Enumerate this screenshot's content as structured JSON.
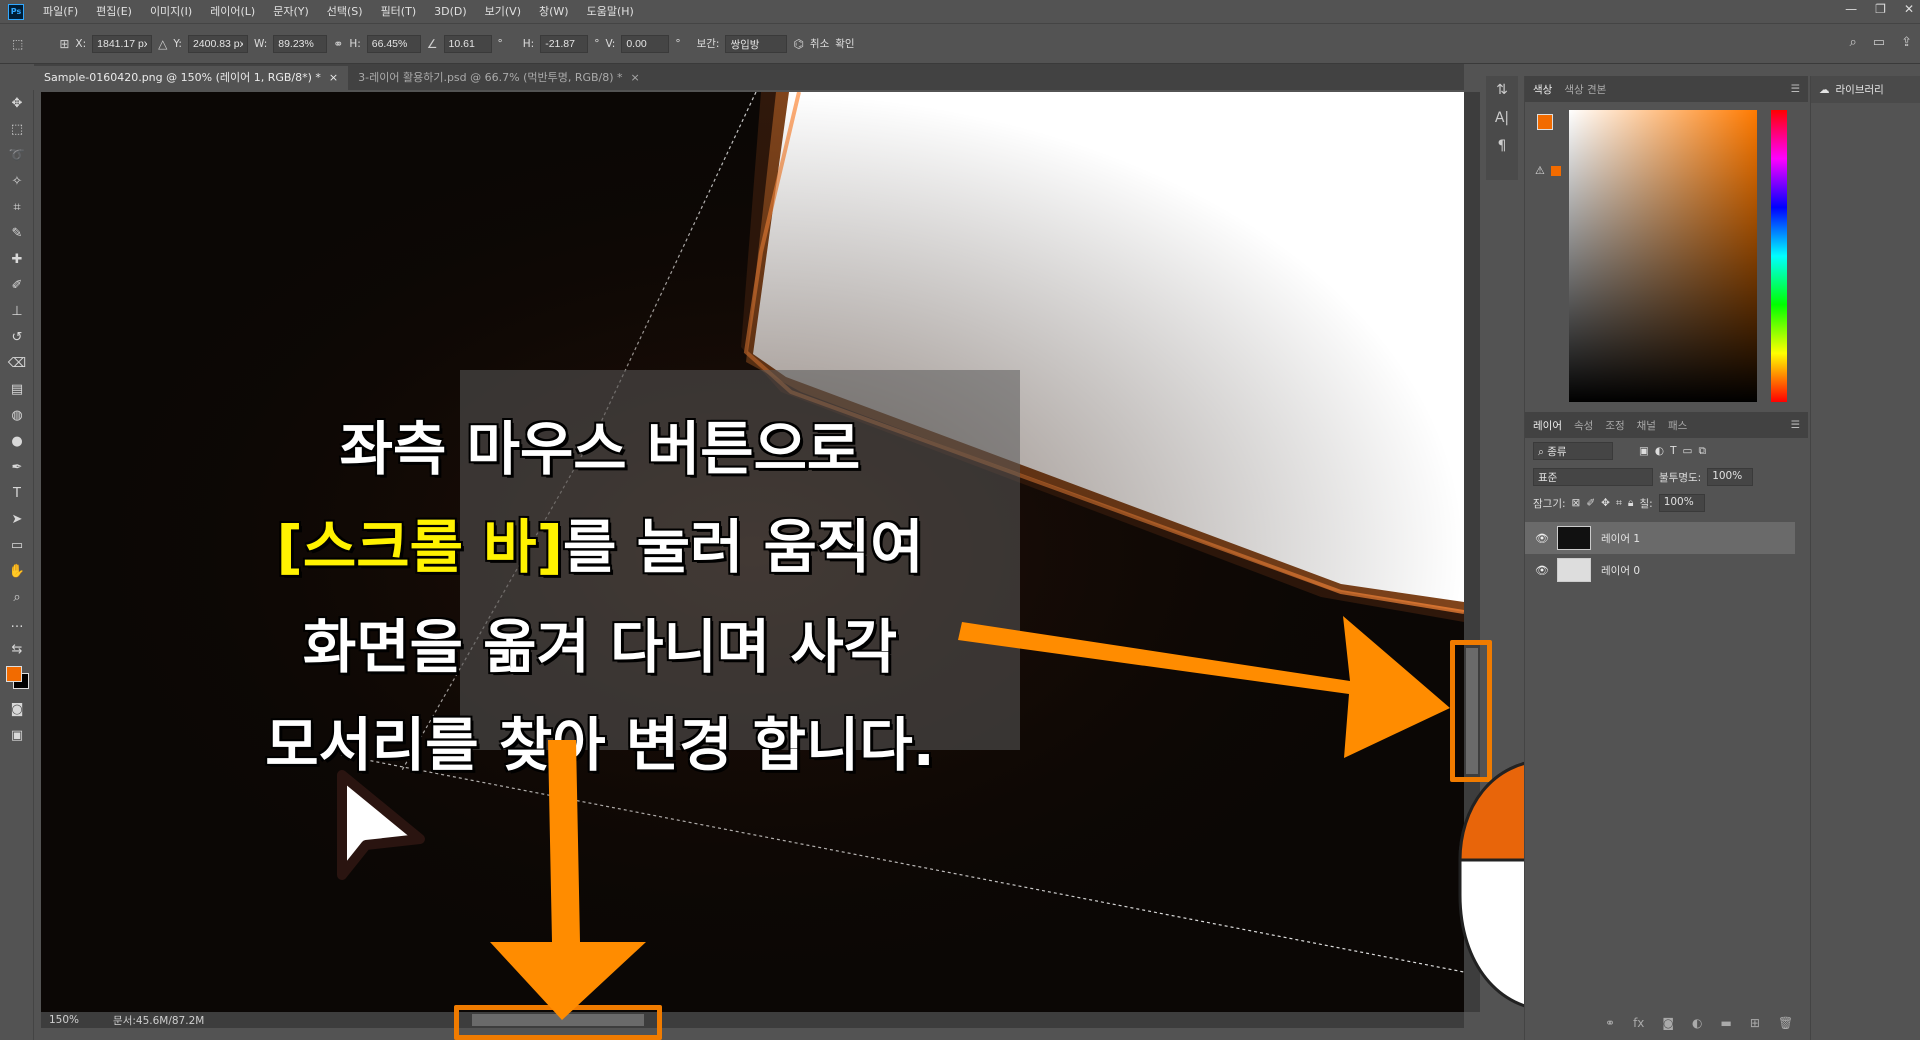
{
  "menubar": {
    "logo": "Ps",
    "items": [
      "파일(F)",
      "편집(E)",
      "이미지(I)",
      "레이어(L)",
      "문자(Y)",
      "선택(S)",
      "필터(T)",
      "3D(D)",
      "보기(V)",
      "창(W)",
      "도움말(H)"
    ]
  },
  "options": {
    "x_label": "X:",
    "x_value": "1841.17 px",
    "y_label": "Y:",
    "y_value": "2400.83 px",
    "w_label": "W:",
    "w_value": "89.23%",
    "h_label": "H:",
    "h_value": "66.45%",
    "angle_value": "10.61",
    "degree": "°",
    "hskew_label": "H:",
    "hskew_value": "-21.87",
    "vskew_label": "V:",
    "vskew_value": "0.00",
    "interp_label": "보간:",
    "interp_value": "쌍입방",
    "cancel_label": "취소",
    "commit_label": "확인"
  },
  "tabs": [
    {
      "label": "Sample-0160420.png @ 150% (레이어 1, RGB/8*) *",
      "close": "×"
    },
    {
      "label": "3-레이어 활용하기.psd @ 66.7% (먹반투명, RGB/8) *",
      "close": "×"
    }
  ],
  "status": {
    "zoom": "150%",
    "doc": "문서:45.6M/87.2M"
  },
  "overlay": {
    "line1": "좌측 마우스 버튼으로",
    "line2_highlight": "[스크롤 바]",
    "line2_rest": "를 눌러 움직여",
    "line3": "화면을 옮겨 다니며 사각",
    "line4": "모서리를 찾아 변경 합니다."
  },
  "color_panel": {
    "tabs": [
      "색상",
      "색상 견본"
    ],
    "fg_color": "#f26b00",
    "bg_color": "#000000"
  },
  "layers_panel": {
    "tabs": [
      "레이어",
      "속성",
      "조정",
      "채널",
      "패스"
    ],
    "filter_label": "종류",
    "blend_mode": "표준",
    "opacity_label": "불투명도:",
    "opacity_value": "100%",
    "lock_label": "잠그기:",
    "fill_label": "칠:",
    "fill_value": "100%",
    "layers": [
      {
        "name": "레이어 1",
        "selected": true
      },
      {
        "name": "레이어 0",
        "selected": false
      }
    ]
  },
  "library": {
    "label": "라이브러리"
  },
  "colors": {
    "accent": "#f07b00",
    "highlight_text": "#fff200"
  }
}
